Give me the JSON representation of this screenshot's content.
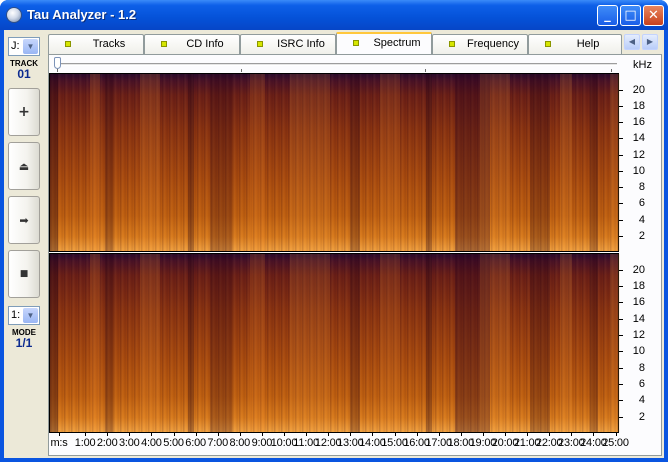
{
  "window": {
    "title": "Tau Analyzer - 1.2",
    "controls": {
      "minimize": "_",
      "maximize": "□",
      "close": "✕"
    }
  },
  "left_panel": {
    "drive": "J:",
    "track_caption": "TRACK",
    "track_value": "01",
    "buttons": [
      {
        "name": "add-button",
        "icon": "plus-icon",
        "glyph": "+"
      },
      {
        "name": "eject-button",
        "icon": "eject-icon",
        "glyph": "⏏"
      },
      {
        "name": "forward-button",
        "icon": "arrow-right-icon",
        "glyph": "➡"
      },
      {
        "name": "stop-button",
        "icon": "stop-icon",
        "glyph": "■"
      }
    ],
    "mode_select": "1:",
    "mode_caption": "MODE",
    "mode_value": "1/1"
  },
  "tabs": [
    {
      "label": "Tracks",
      "active": false
    },
    {
      "label": "CD Info",
      "active": false
    },
    {
      "label": "ISRC Info",
      "active": false
    },
    {
      "label": "Spectrum",
      "active": true
    },
    {
      "label": "Frequency",
      "active": false
    },
    {
      "label": "Help",
      "active": false
    }
  ],
  "tab_scroll": {
    "left": "◀",
    "right": "▶"
  },
  "spectrum": {
    "unit": "kHz",
    "y_ticks": [
      "20",
      "18",
      "16",
      "14",
      "12",
      "10",
      "8",
      "6",
      "4",
      "2"
    ],
    "x_labels": [
      "m:s",
      "1:00",
      "2:00",
      "3:00",
      "4:00",
      "5:00",
      "6:00",
      "7:00",
      "8:00",
      "9:00",
      "10:00",
      "11:00",
      "12:00",
      "13:00",
      "14:00",
      "15:00",
      "16:00",
      "17:00",
      "18:00",
      "19:00",
      "20:00",
      "21:00",
      "22:00",
      "23:00",
      "24:00",
      "25:00"
    ],
    "colors": {
      "dark": "#2a0a2c",
      "mid": "#a84a0e",
      "bright": "#f0a040"
    }
  }
}
